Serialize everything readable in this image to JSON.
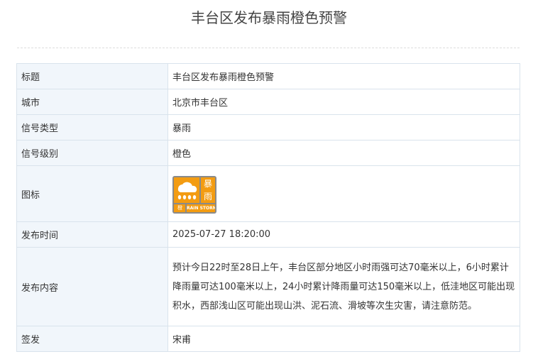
{
  "page": {
    "title": "丰台区发布暴雨橙色预警"
  },
  "rows": [
    {
      "label": "标题",
      "value": "丰台区发布暴雨橙色预警"
    },
    {
      "label": "城市",
      "value": "北京市丰台区"
    },
    {
      "label": "信号类型",
      "value": "暴雨"
    },
    {
      "label": "信号级别",
      "value": "橙色"
    },
    {
      "label": "图标"
    },
    {
      "label": "发布时间",
      "value": "2025-07-27 18:20:00"
    },
    {
      "label": "发布内容",
      "value": "预计今日22时至28日上午，丰台区部分地区小时雨强可达70毫米以上，6小时累计降雨量可达100毫米以上，24小时累计降雨量可达150毫米以上，低洼地区可能出现积水，西部浅山区可能出现山洪、泥石流、滑坡等次生灾害，请注意防范。"
    },
    {
      "label": "签发",
      "value": "宋甫"
    }
  ],
  "icon": {
    "name": "rainstorm-orange-signal-icon",
    "char_top": "暴",
    "char_bottom": "雨",
    "level_char": "橙",
    "caption": "RAIN STORM",
    "colors": {
      "frame": "#8a8a8a",
      "accent": "#f39c12"
    }
  }
}
